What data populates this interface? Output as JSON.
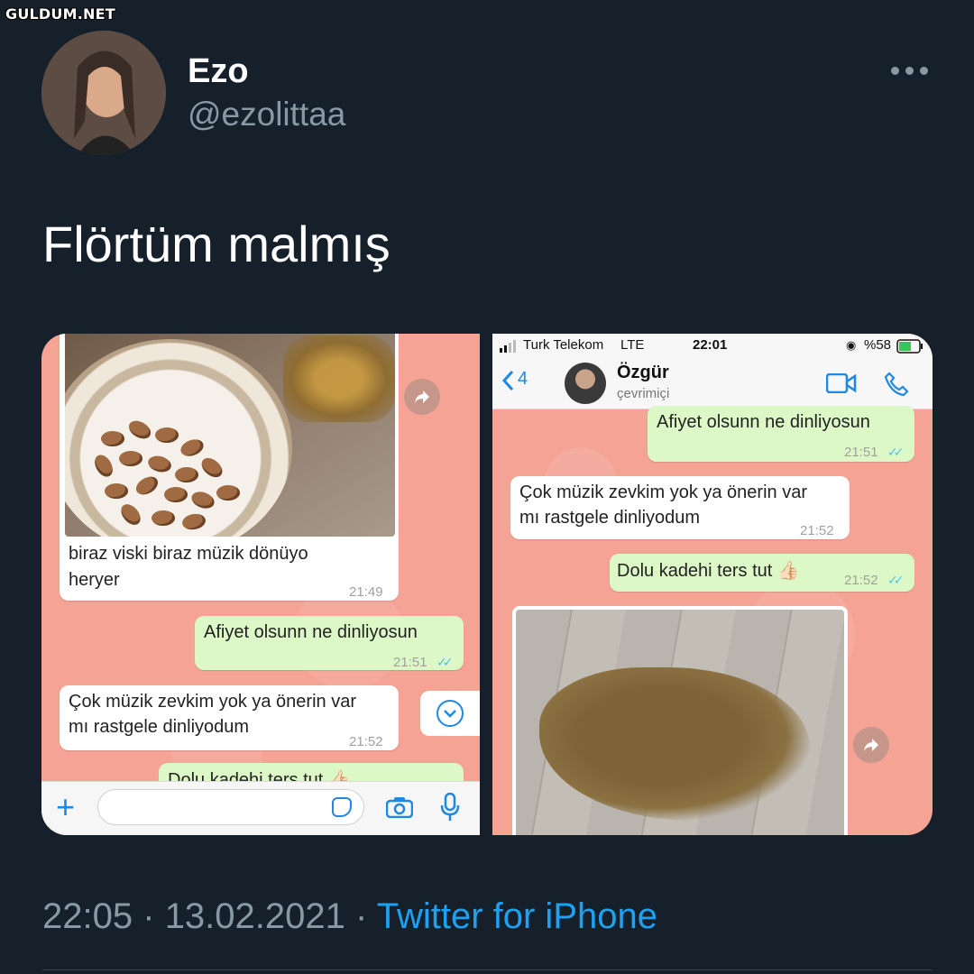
{
  "watermark": "GULDUM.NET",
  "tweet": {
    "display_name": "Ezo",
    "handle": "@ezolittaa",
    "text": "Flörtüm malmış",
    "footer": {
      "time": "22:05",
      "separator": "·",
      "date": "13.02.2021",
      "source": "Twitter for iPhone"
    }
  },
  "left_chat": {
    "messages": [
      {
        "line1": "biraz viski biraz müzik dönüyo",
        "line2": "heryer",
        "time": "21:49"
      },
      {
        "line1": "Afiyet olsunn ne dinliyosun",
        "time": "21:51"
      },
      {
        "line1": "Çok müzik zevkim yok ya önerin var",
        "line2": "mı rastgele dinliyodum",
        "time": "21:52"
      },
      {
        "line1": "Dolu kadehi ters tut 👍🏻"
      }
    ]
  },
  "right_chat": {
    "status_bar": {
      "carrier": "Turk Telekom",
      "network": "LTE",
      "clock": "22:01",
      "battery": "%58"
    },
    "header": {
      "back_count": "4",
      "contact_name": "Özgür",
      "contact_status": "çevrimiçi"
    },
    "messages": [
      {
        "line1": "Afiyet olsunn ne dinliyosun",
        "time": "21:51"
      },
      {
        "line1": "Çok müzik zevkim yok ya önerin var",
        "line2": "mı rastgele dinliyodum",
        "time": "21:52"
      },
      {
        "line1": "Dolu kadehi ters tut 👍🏻",
        "time": "21:52"
      }
    ]
  },
  "colors": {
    "background": "#15202b",
    "secondary_text": "#8899a6",
    "link": "#1da1f2",
    "chat_background": "#f4a395",
    "outgoing_bubble": "#dcf8c6",
    "incoming_bubble": "#ffffff",
    "whatsapp_blue": "#1e88e5"
  },
  "icons": [
    "more-icon",
    "forward-icon",
    "plus-icon",
    "sticker-icon",
    "camera-icon",
    "mic-icon",
    "scroll-down-icon",
    "back-chevron-icon",
    "video-call-icon",
    "phone-call-icon",
    "signal-icon",
    "battery-icon"
  ]
}
